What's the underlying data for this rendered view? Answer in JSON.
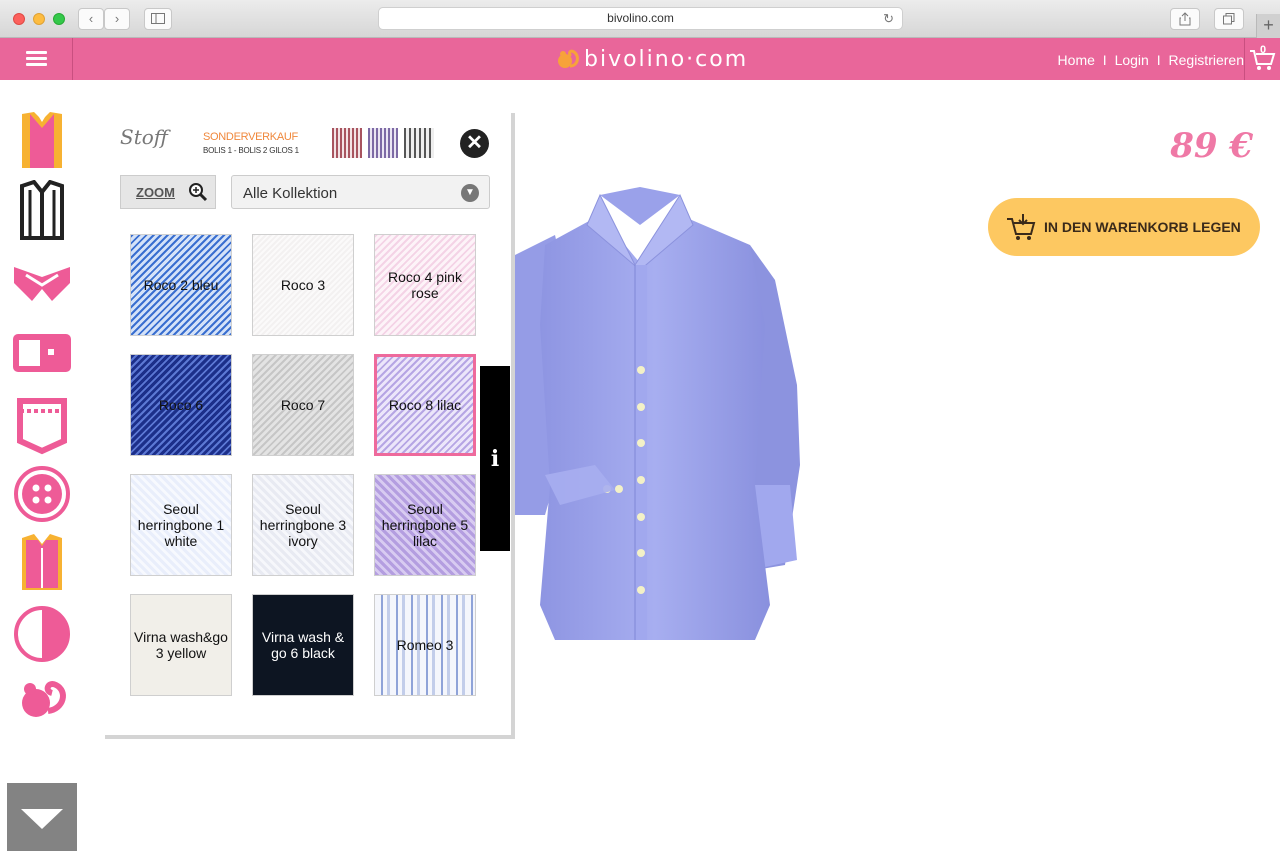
{
  "browser": {
    "url": "bivolino.com",
    "new_tab": "+"
  },
  "header": {
    "logo_text": "bivolino·com",
    "links": [
      "Home",
      "Login",
      "Registrieren"
    ],
    "separator": "I",
    "cart_count": "0"
  },
  "panel": {
    "title": "Stoff",
    "sale_label": "SONDERVERKAUF",
    "sale_sub": "BOLIS 1 - BOLIS 2  GILOS 1",
    "close_symbol": "✕",
    "zoom_label": "ZOOM",
    "collection_select": "Alle Kollektion",
    "fabrics": [
      {
        "label": "Roco 2 bleu",
        "pattern": "blue-twill",
        "selected": false
      },
      {
        "label": "Roco 3",
        "pattern": "white-plain",
        "selected": false
      },
      {
        "label": "Roco 4 pink rose",
        "pattern": "pink-twill",
        "selected": false
      },
      {
        "label": "Roco 6",
        "pattern": "navy-twill",
        "selected": false
      },
      {
        "label": "Roco 7",
        "pattern": "grey-twill",
        "selected": false
      },
      {
        "label": "Roco 8 lilac",
        "pattern": "lilac-twill",
        "selected": true
      },
      {
        "label": "Seoul herringbone 1 white",
        "pattern": "white-herringbone",
        "selected": false
      },
      {
        "label": "Seoul herringbone 3 ivory",
        "pattern": "ivory-herringbone",
        "selected": false
      },
      {
        "label": "Seoul herringbone 5 lilac",
        "pattern": "lilac-herringbone",
        "selected": false
      },
      {
        "label": "Virna wash&go 3 yellow",
        "pattern": "cream-plain",
        "selected": false
      },
      {
        "label": "Virna wash & go 6 black",
        "pattern": "black-plain",
        "selected": false
      },
      {
        "label": "Romeo 3",
        "pattern": "blue-stripe",
        "selected": false
      }
    ]
  },
  "info_tab": "i",
  "product": {
    "price": "89 €",
    "add_to_cart": "IN DEN WARENKORB LEGEN",
    "shirt_color": "#9fa6ec"
  },
  "colors": {
    "brand_pink": "#e9669a",
    "button_yellow": "#fdc861"
  }
}
